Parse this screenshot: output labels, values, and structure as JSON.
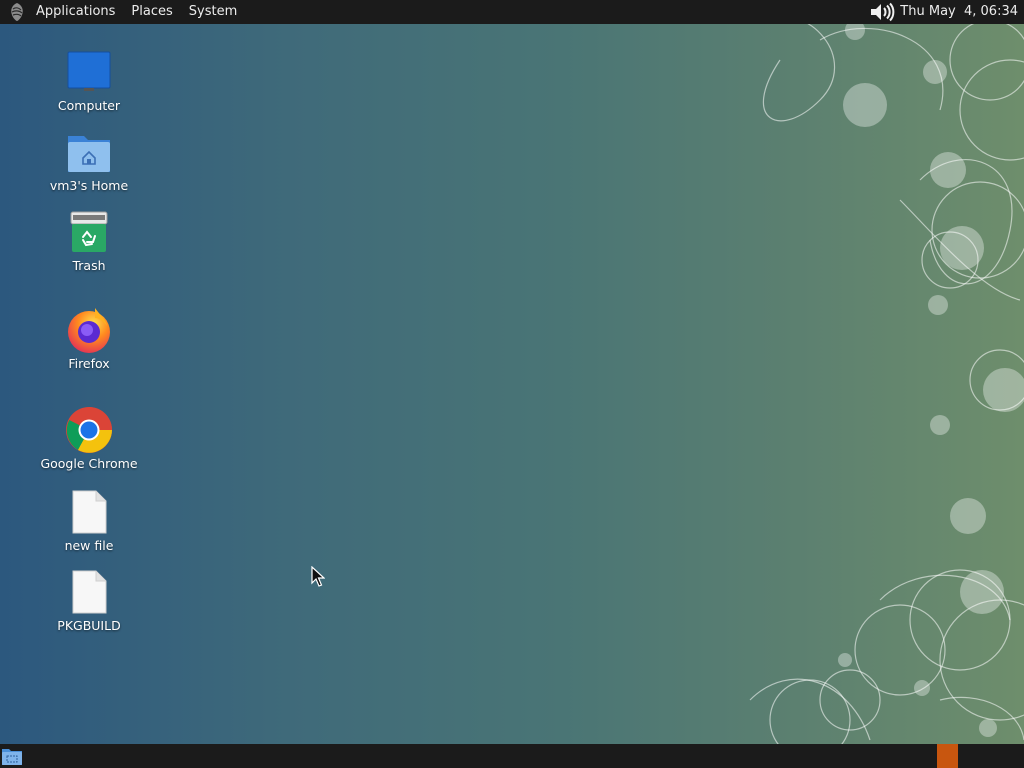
{
  "top_panel": {
    "menus": [
      "Applications",
      "Places",
      "System"
    ],
    "clock": "Thu May  4, 06:34"
  },
  "desktop": {
    "icons": [
      {
        "label": "Computer",
        "icon": "computer-monitor-icon"
      },
      {
        "label": "vm3's Home",
        "icon": "home-folder-icon"
      },
      {
        "label": "Trash",
        "icon": "trash-icon"
      },
      {
        "label": "Firefox",
        "icon": "firefox-icon"
      },
      {
        "label": "Google Chrome",
        "icon": "chrome-icon"
      },
      {
        "label": "new file",
        "icon": "file-icon"
      },
      {
        "label": "PKGBUILD",
        "icon": "file-icon"
      }
    ]
  },
  "colors": {
    "panel": "#1b1b1b",
    "workspace_active": "#c8560f",
    "monitor_blue": "#1f6fd6",
    "trash_green": "#2aa865"
  }
}
